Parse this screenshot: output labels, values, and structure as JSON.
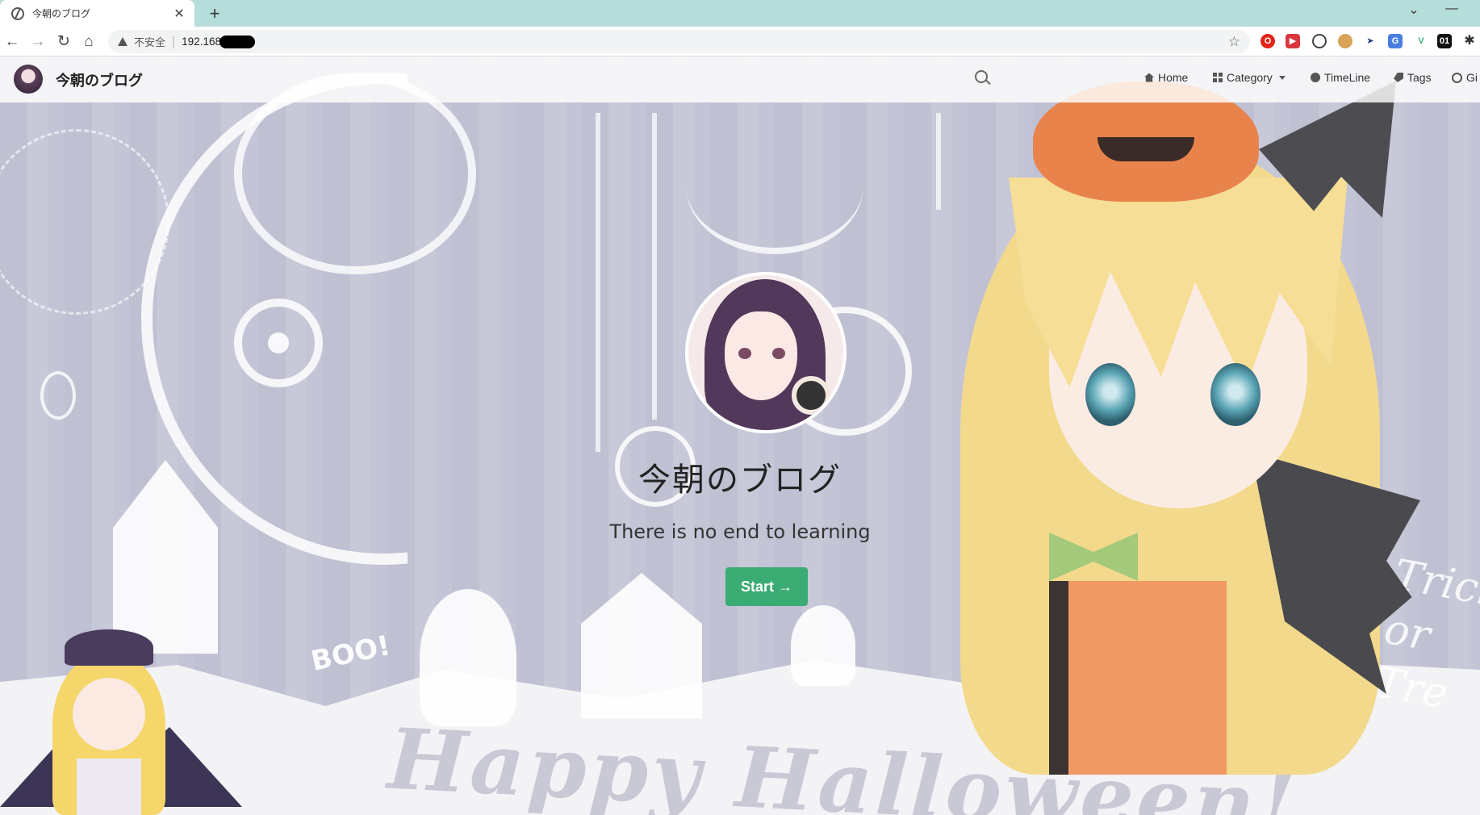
{
  "browser": {
    "tab_title": "今朝のブログ",
    "tab_close": "✕",
    "new_tab": "+",
    "minimize": "—",
    "dropdown": "⌄",
    "insecure_label": "不安全",
    "separator": "|",
    "url": "192.168"
  },
  "site": {
    "brand": "今朝のブログ",
    "search_placeholder": "",
    "nav": [
      {
        "label": "Home",
        "icon": "home-icon"
      },
      {
        "label": "Category",
        "icon": "grid-icon"
      },
      {
        "label": "TimeLine",
        "icon": "clock-icon"
      },
      {
        "label": "Tags",
        "icon": "tag-icon"
      },
      {
        "label": "Gi",
        "icon": "github-icon"
      }
    ]
  },
  "hero": {
    "title": "今朝のブログ",
    "subtitle": "There is no end to learning",
    "start_label": "Start →"
  },
  "background": {
    "boo": "BOO!",
    "halloween": "Happy Halloween!",
    "trick": "Trick or Tre"
  },
  "colors": {
    "tabstrip": "#b5ddd9",
    "start_button": "#3bab74"
  }
}
